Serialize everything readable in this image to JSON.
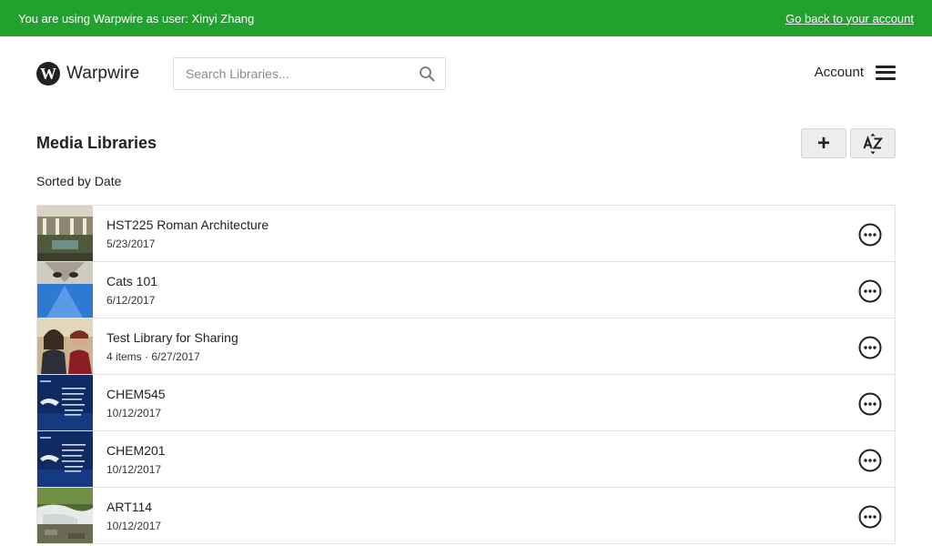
{
  "banner": {
    "message": "You are using Warpwire as user: Xinyi Zhang",
    "back_link": "Go back to your account"
  },
  "header": {
    "logo_letter": "W",
    "logo_text": "Warpwire",
    "search_placeholder": "Search Libraries...",
    "account_label": "Account"
  },
  "main": {
    "title": "Media Libraries",
    "add_button_label": "+",
    "sort_button_icon": "az-sort-icon",
    "sort_status": "Sorted by Date"
  },
  "libraries": [
    {
      "title": "HST225 Roman Architecture",
      "meta": "5/23/2017",
      "thumbnail": "courtyard-photo"
    },
    {
      "title": "Cats 101",
      "meta": "6/12/2017",
      "thumbnail": "cat-photo"
    },
    {
      "title": "Test Library for Sharing",
      "meta": "4 items · 6/27/2017",
      "thumbnail": "people-photo"
    },
    {
      "title": "CHEM545",
      "meta": "10/12/2017",
      "thumbnail": "presentation-slide"
    },
    {
      "title": "CHEM201",
      "meta": "10/12/2017",
      "thumbnail": "presentation-slide"
    },
    {
      "title": "ART114",
      "meta": "10/12/2017",
      "thumbnail": "waterfall-photo"
    }
  ],
  "colors": {
    "banner_bg": "#23a12f",
    "text": "#222222",
    "border": "#e3e3e3",
    "button_bg": "#ededed"
  }
}
